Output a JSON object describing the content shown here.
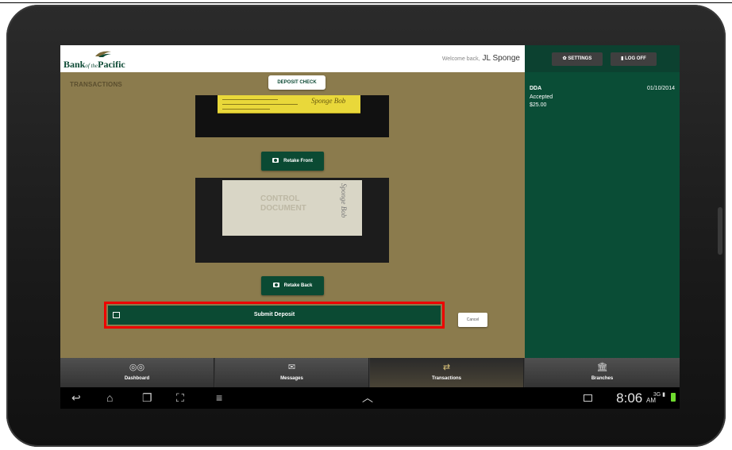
{
  "header": {
    "logo_text": "Bank",
    "logo_small": "of the",
    "logo_text2": "Pacific",
    "welcome_prefix": "Welcome back,",
    "user_name": "JL Sponge"
  },
  "top_buttons": {
    "settings": "SETTINGS",
    "logoff": "LOG OFF"
  },
  "main": {
    "section_title": "TRANSACTIONS",
    "tab_label": "DEPOSIT CHECK",
    "retake_front": "Retake Front",
    "retake_back": "Retake Back",
    "submit": "Submit Deposit",
    "cancel": "Cancel",
    "front_signature": "Sponge Bob",
    "back_stamp_line1": "CONTROL",
    "back_stamp_line2": "DOCUMENT",
    "back_signature": "Sponge Bob"
  },
  "recent": {
    "account": "DDA",
    "date": "01/10/2014",
    "status": "Accepted",
    "amount": "$25.00"
  },
  "bottom_nav": [
    {
      "label": "Dashboard",
      "icon": "glasses-icon"
    },
    {
      "label": "Messages",
      "icon": "envelope-icon"
    },
    {
      "label": "Transactions",
      "icon": "transfer-arrows-icon"
    },
    {
      "label": "Branches",
      "icon": "bank-building-icon"
    }
  ],
  "system_bar": {
    "time": "8:06",
    "ampm": "AM",
    "network": "3G"
  },
  "colors": {
    "brand_green": "#0b4a33",
    "content_bg": "#8b7b4d",
    "highlight_red": "#e00000"
  }
}
